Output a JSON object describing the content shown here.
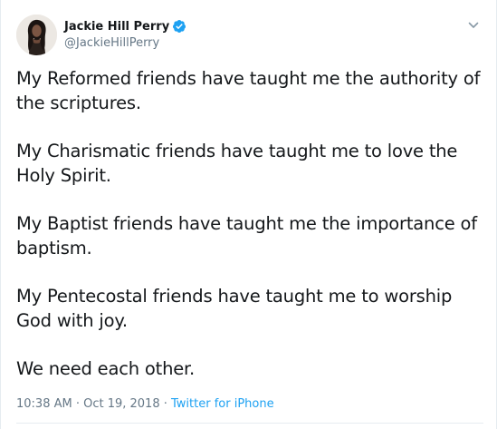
{
  "author": {
    "display_name": "Jackie Hill Perry",
    "handle": "@JackieHillPerry",
    "verified": true
  },
  "tweet": {
    "paragraphs": [
      "My Reformed friends have taught me the authority of the scriptures.",
      "My Charismatic friends have taught me to love the Holy Spirit.",
      "My Baptist friends have taught me the importance of baptism.",
      "My Pentecostal friends have taught me to worship God with joy.",
      "We need each other."
    ],
    "timestamp": "10:38 AM · Oct 19, 2018",
    "separator": " · ",
    "source": "Twitter for iPhone"
  },
  "icons": {
    "verified": "verified-badge-icon",
    "menu": "chevron-down-icon"
  },
  "colors": {
    "text": "#14171a",
    "secondary": "#657786",
    "accent": "#1da1f2",
    "border": "#e6ecf0"
  }
}
